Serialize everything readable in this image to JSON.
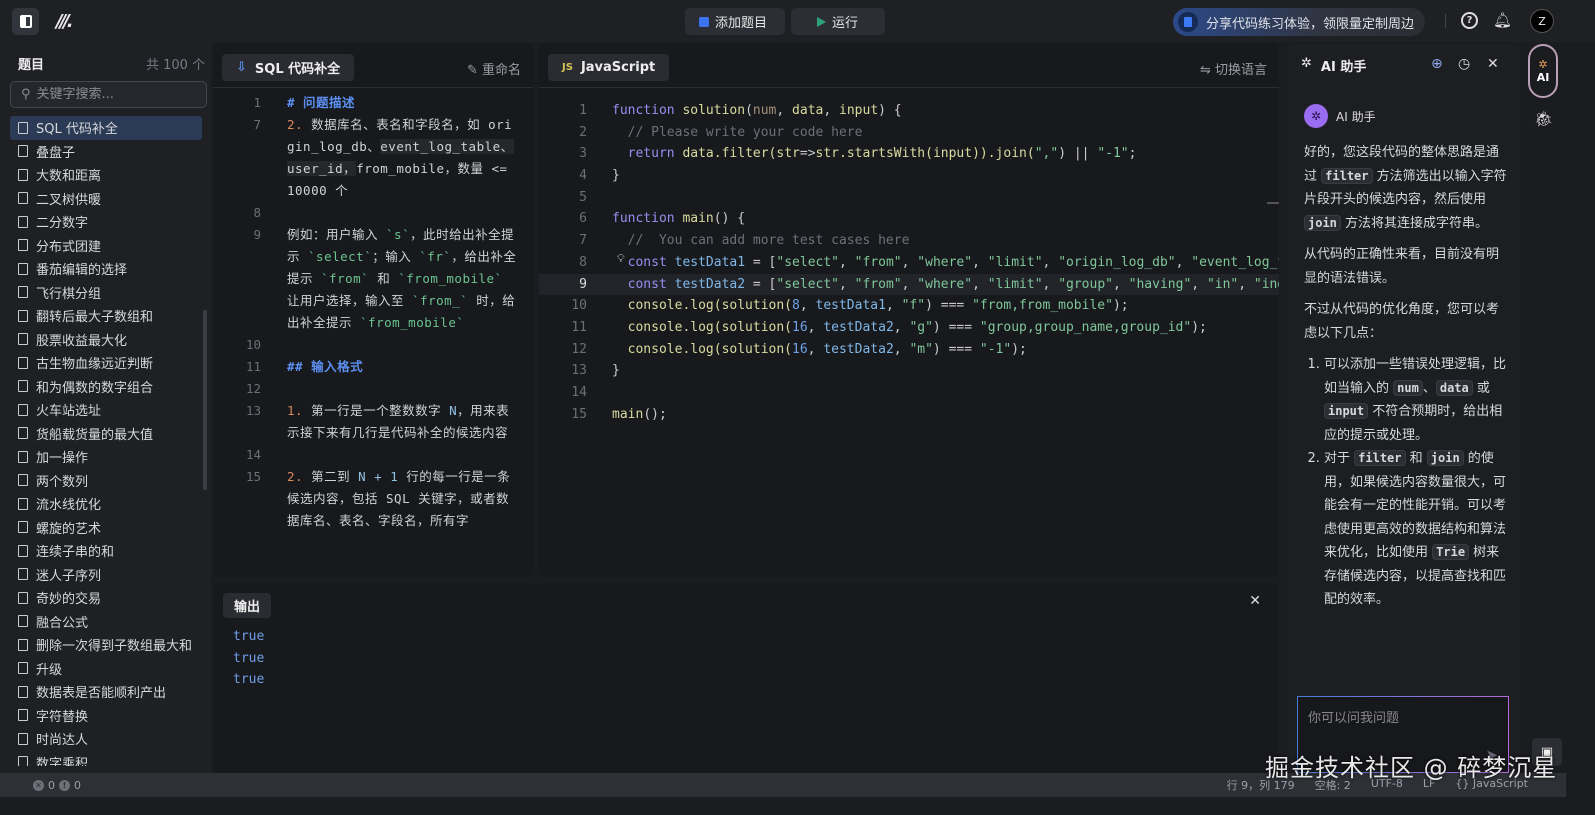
{
  "topbar": {
    "add_problem": "添加题目",
    "run": "运行",
    "promo": "分享代码练习体验，领限量定制周边",
    "help": "?",
    "avatar": "Z"
  },
  "sidebar": {
    "title": "题目",
    "count": "共 100 个",
    "search_placeholder": "关键字搜索...",
    "items": [
      "SQL 代码补全",
      "叠盘子",
      "大数和距离",
      "二叉树供暖",
      "二分数字",
      "分布式团建",
      "番茄编辑的选择",
      "飞行棋分组",
      "翻转后最大子数组和",
      "股票收益最大化",
      "古生物血缘远近判断",
      "和为偶数的数字组合",
      "火车站选址",
      "货船载货量的最大值",
      "加一操作",
      "两个数列",
      "流水线优化",
      "螺旋的艺术",
      "连续子串的和",
      "迷人子序列",
      "奇妙的交易",
      "融合公式",
      "删除一次得到子数组最大和",
      "升级",
      "数据表是否能顺利产出",
      "字符替换",
      "时尚达人",
      "数字乘积"
    ]
  },
  "problem": {
    "tab": "SQL 代码补全",
    "rename": "重命名",
    "lines": [
      {
        "n": "1",
        "t": [
          [
            "# 问题描述",
            "m-h"
          ]
        ]
      },
      {
        "n": "7",
        "t": [
          [
            "2.",
            "m-n"
          ],
          [
            " 数据库名、表名和字段名，如 origin_log_db、",
            ""
          ],
          [
            "event_log_table、user_id，",
            "hlseg"
          ],
          [
            "from_mobile，数量 <= 10000 个",
            ""
          ]
        ]
      },
      {
        "n": "8",
        "t": []
      },
      {
        "n": "9",
        "t": [
          [
            "例如：用户输入 ",
            ""
          ],
          [
            "`s`",
            "m-code"
          ],
          [
            "，此时给出补全提示 ",
            ""
          ],
          [
            "`select`",
            "m-code"
          ],
          [
            "；输入 ",
            ""
          ],
          [
            "`fr`",
            "m-code"
          ],
          [
            "，给出补全提示 ",
            ""
          ],
          [
            "`from`",
            "m-code"
          ],
          [
            " 和 ",
            ""
          ],
          [
            "`from_mobile`",
            "m-code"
          ],
          [
            " 让用户选择，输入至 ",
            ""
          ],
          [
            "`from_`",
            "m-code"
          ],
          [
            " 时，给出补全提示 ",
            ""
          ],
          [
            "`from_mobile`",
            "m-code"
          ]
        ]
      },
      {
        "n": "10",
        "t": []
      },
      {
        "n": "11",
        "t": [
          [
            "## 输入格式",
            "m-h"
          ]
        ]
      },
      {
        "n": "12",
        "t": []
      },
      {
        "n": "13",
        "t": [
          [
            "1.",
            "m-n"
          ],
          [
            " 第一行是一个整数数字 ",
            ""
          ],
          [
            "N",
            "m-b"
          ],
          [
            "，用来表示接下来有几行是代码补全的候选内容",
            ""
          ]
        ]
      },
      {
        "n": "14",
        "t": []
      },
      {
        "n": "15",
        "t": [
          [
            "2.",
            "m-n"
          ],
          [
            " 第二到 ",
            ""
          ],
          [
            "N + 1",
            "m-b"
          ],
          [
            " 行的每一行是一条候选内容，包括 SQL 关键字，或者数据库名、表名、字段名，所有字",
            ""
          ]
        ]
      }
    ]
  },
  "editor": {
    "tab": "JavaScript",
    "tab_icon": "JS",
    "switch": "切换语言",
    "current_line": "9",
    "lines": [
      [
        [
          "function ",
          "k-kw"
        ],
        [
          "solution",
          "k-fn"
        ],
        [
          "(",
          "k-op"
        ],
        [
          "num",
          "k-par"
        ],
        [
          ", ",
          "k-op"
        ],
        [
          "data",
          "k-fn"
        ],
        [
          ", ",
          "k-op"
        ],
        [
          "input",
          "k-fn"
        ],
        [
          ") {",
          "k-op"
        ]
      ],
      [
        [
          "  // Please write your code here",
          "k-cm"
        ]
      ],
      [
        [
          "  return ",
          "k-kw"
        ],
        [
          "data",
          "k-fn"
        ],
        [
          ".filter(",
          "k-fn"
        ],
        [
          "str",
          "k-fn"
        ],
        [
          "=>",
          "k-op"
        ],
        [
          "str.startsWith(",
          "k-fn"
        ],
        [
          "input",
          "k-fn"
        ],
        [
          ")).join(",
          "k-fn"
        ],
        [
          "\",\"",
          "k-str"
        ],
        [
          ") || ",
          "k-op"
        ],
        [
          "\"-1\"",
          "k-str"
        ],
        [
          ";",
          "k-op"
        ]
      ],
      [
        [
          "}",
          "k-op"
        ]
      ],
      [],
      [
        [
          "function ",
          "k-kw"
        ],
        [
          "main",
          "k-fn"
        ],
        [
          "() {",
          "k-op"
        ]
      ],
      [
        [
          "  //  You can add more test cases here",
          "k-cm"
        ]
      ],
      [
        [
          "  const ",
          "k-kw"
        ],
        [
          "testData1",
          "k-var"
        ],
        [
          " = [",
          "k-op"
        ],
        [
          "\"select\"",
          "k-str"
        ],
        [
          ", ",
          "k-op"
        ],
        [
          "\"from\"",
          "k-str"
        ],
        [
          ", ",
          "k-op"
        ],
        [
          "\"where\"",
          "k-str"
        ],
        [
          ", ",
          "k-op"
        ],
        [
          "\"limit\"",
          "k-str"
        ],
        [
          ", ",
          "k-op"
        ],
        [
          "\"origin_log_db\"",
          "k-str"
        ],
        [
          ", ",
          "k-op"
        ],
        [
          "\"event_log_ta",
          "k-str"
        ]
      ],
      [
        [
          "  const ",
          "k-kw"
        ],
        [
          "testData2",
          "k-var"
        ],
        [
          " = [",
          "k-op"
        ],
        [
          "\"select\"",
          "k-str"
        ],
        [
          ", ",
          "k-op"
        ],
        [
          "\"from\"",
          "k-str"
        ],
        [
          ", ",
          "k-op"
        ],
        [
          "\"where\"",
          "k-str"
        ],
        [
          ", ",
          "k-op"
        ],
        [
          "\"limit\"",
          "k-str"
        ],
        [
          ", ",
          "k-op"
        ],
        [
          "\"group\"",
          "k-str"
        ],
        [
          ", ",
          "k-op"
        ],
        [
          "\"having\"",
          "k-str"
        ],
        [
          ", ",
          "k-op"
        ],
        [
          "\"in\"",
          "k-str"
        ],
        [
          ", ",
          "k-op"
        ],
        [
          "\"inde",
          "k-str"
        ]
      ],
      [
        [
          "  console.log(solution(",
          "k-fn"
        ],
        [
          "8",
          "k-num"
        ],
        [
          ", ",
          "k-op"
        ],
        [
          "testData1",
          "k-var"
        ],
        [
          ", ",
          "k-op"
        ],
        [
          "\"f\"",
          "k-str"
        ],
        [
          ") === ",
          "k-op"
        ],
        [
          "\"from,from_mobile\"",
          "k-str"
        ],
        [
          ");",
          "k-op"
        ]
      ],
      [
        [
          "  console.log(solution(",
          "k-fn"
        ],
        [
          "16",
          "k-num"
        ],
        [
          ", ",
          "k-op"
        ],
        [
          "testData2",
          "k-var"
        ],
        [
          ", ",
          "k-op"
        ],
        [
          "\"g\"",
          "k-str"
        ],
        [
          ") === ",
          "k-op"
        ],
        [
          "\"group,group_name,group_id\"",
          "k-str"
        ],
        [
          ");",
          "k-op"
        ]
      ],
      [
        [
          "  console.log(solution(",
          "k-fn"
        ],
        [
          "16",
          "k-num"
        ],
        [
          ", ",
          "k-op"
        ],
        [
          "testData2",
          "k-var"
        ],
        [
          ", ",
          "k-op"
        ],
        [
          "\"m\"",
          "k-str"
        ],
        [
          ") === ",
          "k-op"
        ],
        [
          "\"-1\"",
          "k-str"
        ],
        [
          ");",
          "k-op"
        ]
      ],
      [
        [
          "}",
          "k-op"
        ]
      ],
      [],
      [
        [
          "main",
          "k-fn"
        ],
        [
          "();",
          "k-op"
        ]
      ]
    ]
  },
  "output": {
    "tab": "输出",
    "lines": [
      "true",
      "true",
      "true"
    ]
  },
  "ai": {
    "title": "AI 助手",
    "sender": "AI 助手",
    "input_placeholder": "你可以问我问题",
    "paragraphs": [
      [
        [
          "好的，您这段代码的整体思路是通过 ",
          ""
        ],
        [
          "filter",
          "c"
        ],
        [
          " 方法筛选出以输入字符片段开头的候选内容，然后使用 ",
          ""
        ],
        [
          "join",
          "c"
        ],
        [
          " 方法将其连接成字符串。",
          ""
        ]
      ],
      [
        [
          "从代码的正确性来看，目前没有明显的语法错误。",
          ""
        ]
      ],
      [
        [
          "不过从代码的优化角度，您可以考虑以下几点：",
          ""
        ]
      ]
    ],
    "list": [
      [
        [
          "可以添加一些错误处理逻辑，比如当输入的 ",
          ""
        ],
        [
          "num",
          "c"
        ],
        [
          "、",
          ""
        ],
        [
          "data",
          "c"
        ],
        [
          " 或 ",
          ""
        ],
        [
          "input",
          "c"
        ],
        [
          " 不符合预期时，给出相应的提示或处理。",
          ""
        ]
      ],
      [
        [
          "对于 ",
          ""
        ],
        [
          "filter",
          "c"
        ],
        [
          " 和 ",
          ""
        ],
        [
          "join",
          "c"
        ],
        [
          " 的使用，如果候选内容数量很大，可能会有一定的性能开销。可以考虑使用更高效的数据结构和算法来优化，比如使用 ",
          ""
        ],
        [
          "Trie",
          "c"
        ],
        [
          " 树来存储候选内容，以提高查找和匹配的效率。",
          ""
        ]
      ]
    ]
  },
  "rail": {
    "ai_label": "AI"
  },
  "status": {
    "errors": "0",
    "warnings": "0",
    "position": "行 9，列 179",
    "indent": "空格: 2",
    "encoding": "UTF-8",
    "eol": "LF",
    "language": "JavaScript",
    "language_icon": "{}"
  },
  "watermark": "掘金技术社区 @ 碎梦沉星"
}
